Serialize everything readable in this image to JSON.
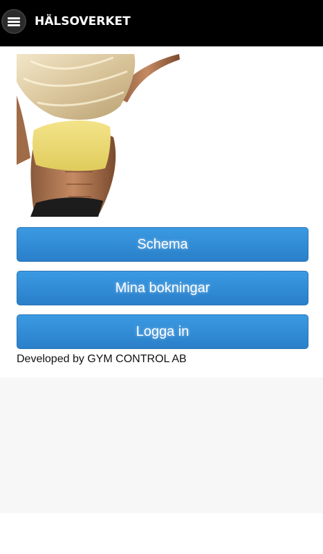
{
  "header": {
    "title": "HÄLSOVERKET",
    "menu_icon": "hamburger-menu-icon",
    "background_color": "#000000"
  },
  "hero": {
    "image": "fitness-woman-photo"
  },
  "buttons": {
    "schedule_label": "Schema",
    "my_bookings_label": "Mina bokningar",
    "login_label": "Logga in",
    "color": "#2f88d2"
  },
  "footer": {
    "credit": "Developed by GYM CONTROL AB"
  }
}
